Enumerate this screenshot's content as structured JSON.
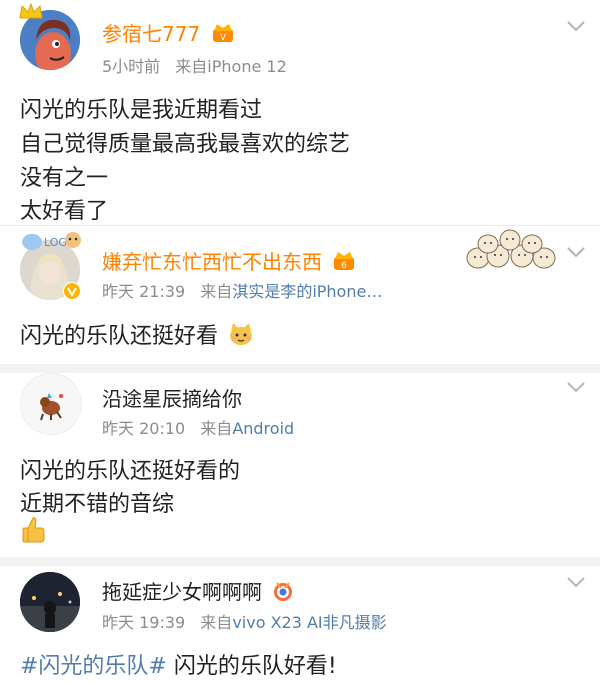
{
  "comments": [
    {
      "name": "参宿七777",
      "time": "5小时前",
      "source_prefix": "来自",
      "source": "iPhone 12",
      "lines": [
        "闪光的乐队是我近期看过",
        "自己觉得质量最高我最喜欢的综艺",
        "没有之一",
        "太好看了"
      ]
    },
    {
      "name": "嫌弃忙东忙西忙不出东西",
      "time": "昨天 21:39",
      "source_prefix": "来自",
      "source": "淇实是李的iPhone…",
      "lines": [
        "闪光的乐队还挺好看"
      ]
    },
    {
      "name": "沿途星辰摘给你",
      "time": "昨天 20:10",
      "source_prefix": "来自",
      "source": "Android",
      "lines": [
        "闪光的乐队还挺好看的",
        "近期不错的音综"
      ]
    },
    {
      "name": "拖延症少女啊啊啊",
      "time": "昨天 19:39",
      "source_prefix": "来自",
      "source": "vivo X23 AI非凡摄影",
      "hashtag": "#闪光的乐队#",
      "lines": [
        " 闪光的乐队好看!"
      ]
    }
  ],
  "icons": {
    "vip_badge": "crown-vip-badge-icon",
    "verified": "verified-v-icon",
    "menu": "chevron-down-icon",
    "thumbs_up": "thumbs-up-emoji-icon",
    "cat": "cat-emoji-icon",
    "vip_sticker": "bun-crowd-sticker-icon"
  },
  "colors": {
    "vip_name": "#ff8200",
    "link_blue": "#507daf",
    "meta_gray": "#8c8c8c"
  }
}
